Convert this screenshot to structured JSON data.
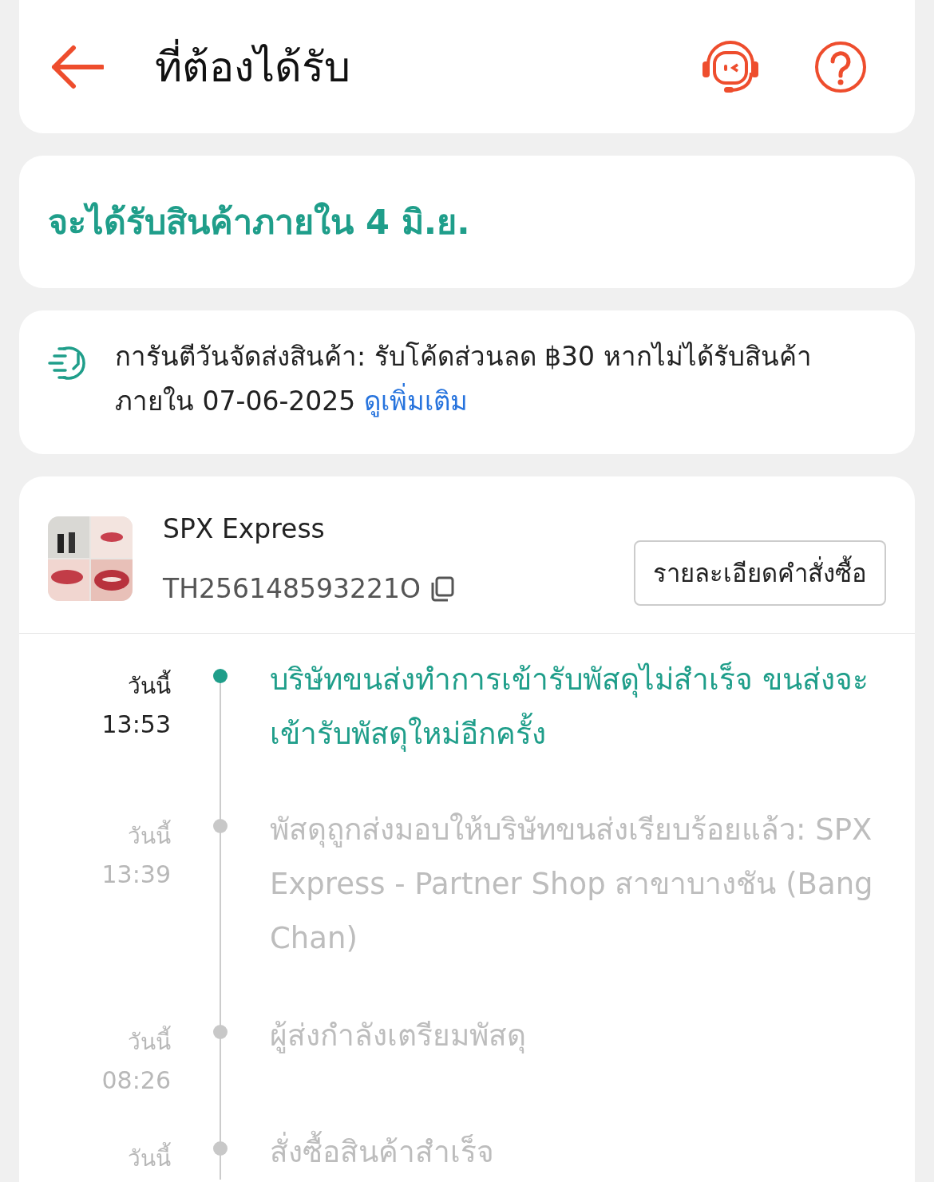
{
  "header": {
    "title": "ที่ต้องได้รับ"
  },
  "delivery_estimate": "จะได้รับสินค้าภายใน 4 มิ.ย.",
  "guarantee": {
    "text": "การันตีวันจัดส่งสินค้า: รับโค้ดส่วนลด ฿30 หากไม่ได้รับสินค้าภายใน 07-06-2025",
    "link": "ดูเพิ่มเติม"
  },
  "shipment": {
    "carrier": "SPX Express",
    "tracking_number": "TH256148593221O",
    "order_details_button": "รายละเอียดคำสั่งซื้อ",
    "events": [
      {
        "date": "วันนี้",
        "time": "13:53",
        "text": "บริษัทขนส่งทำการเข้ารับพัสดุไม่สำเร็จ ขนส่งจะเข้ารับพัสดุใหม่อีกครั้ง",
        "active": true
      },
      {
        "date": "วันนี้",
        "time": "13:39",
        "text": "พัสดุถูกส่งมอบให้บริษัทขนส่งเรียบร้อยแล้ว: SPX Express - Partner Shop สาขาบางชัน (Bang Chan)",
        "active": false
      },
      {
        "date": "วันนี้",
        "time": "08:26",
        "text": "ผู้ส่งกำลังเตรียมพัสดุ",
        "active": false
      },
      {
        "date": "วันนี้",
        "text": "สั่งซื้อสินค้าสำเร็จ",
        "active": false
      }
    ]
  }
}
